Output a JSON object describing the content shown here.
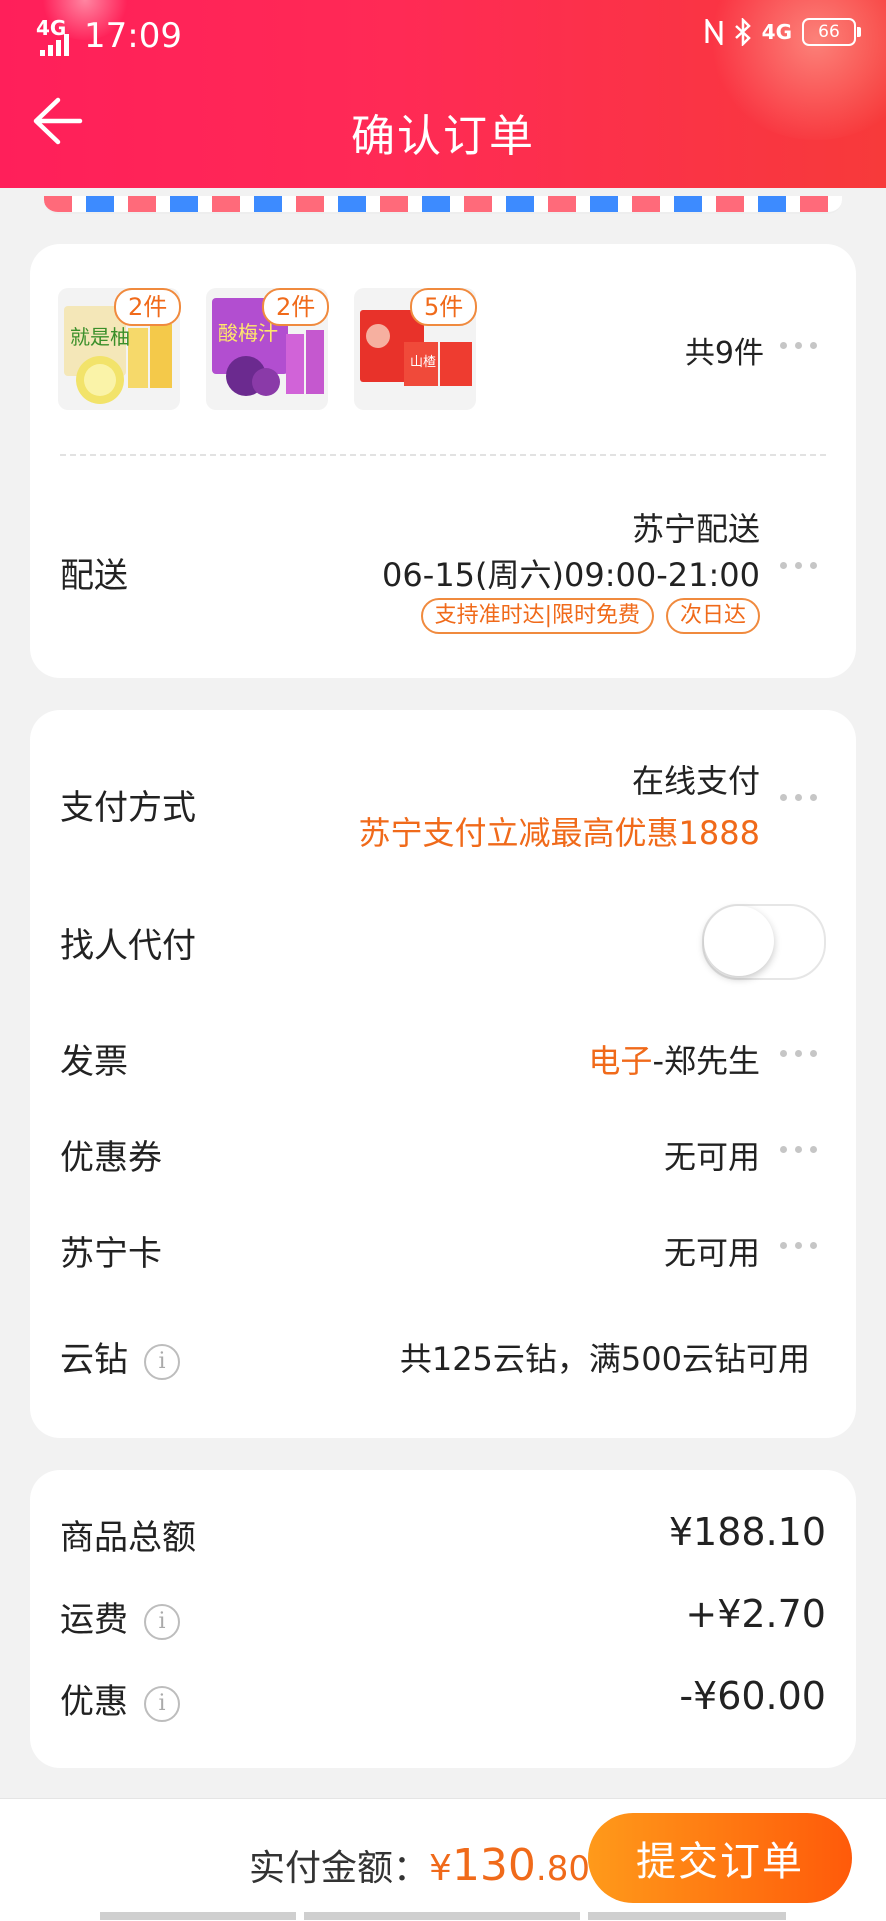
{
  "status_bar": {
    "network": "4G",
    "time": "17:09",
    "right_network": "4G",
    "battery": "66"
  },
  "header": {
    "title": "确认订单"
  },
  "items": {
    "badges": [
      "2件",
      "2件",
      "5件"
    ],
    "product_text": [
      "就是柚",
      "酸梅汁",
      "山楂"
    ],
    "total_count": "共9件"
  },
  "delivery": {
    "label": "配送",
    "provider": "苏宁配送",
    "time": "06-15(周六)09:00-21:00",
    "tags": [
      "支持准时达|限时免费",
      "次日达"
    ]
  },
  "payment": {
    "label": "支付方式",
    "method": "在线支付",
    "promo": "苏宁支付立减最高优惠1888"
  },
  "proxy_pay": {
    "label": "找人代付",
    "enabled": false
  },
  "invoice": {
    "label": "发票",
    "type": "电子",
    "holder": "-郑先生"
  },
  "coupon": {
    "label": "优惠券",
    "value": "无可用"
  },
  "suning_card": {
    "label": "苏宁卡",
    "value": "无可用"
  },
  "cloud_diamond": {
    "label": "云钻",
    "value": "共125云钻，满500云钻可用"
  },
  "summary": {
    "subtotal_label": "商品总额",
    "subtotal": "¥188.10",
    "shipping_label": "运费",
    "shipping": "+¥2.70",
    "discount_label": "优惠",
    "discount": "-¥60.00"
  },
  "footer": {
    "pay_label": "实付金额：",
    "currency": "¥",
    "amount_int": "130",
    "amount_dec": ".80",
    "submit_label": "提交订单"
  },
  "colors": {
    "accent": "#f06a1a",
    "header_start": "#ff1f5a",
    "header_end": "#f73a3a",
    "button_start": "#ff9a1a",
    "button_end": "#ff5a0a"
  },
  "icons": [
    "back-arrow-icon",
    "more-dots-icon",
    "info-icon",
    "signal-icon",
    "nfc-icon",
    "bluetooth-icon",
    "battery-icon"
  ]
}
